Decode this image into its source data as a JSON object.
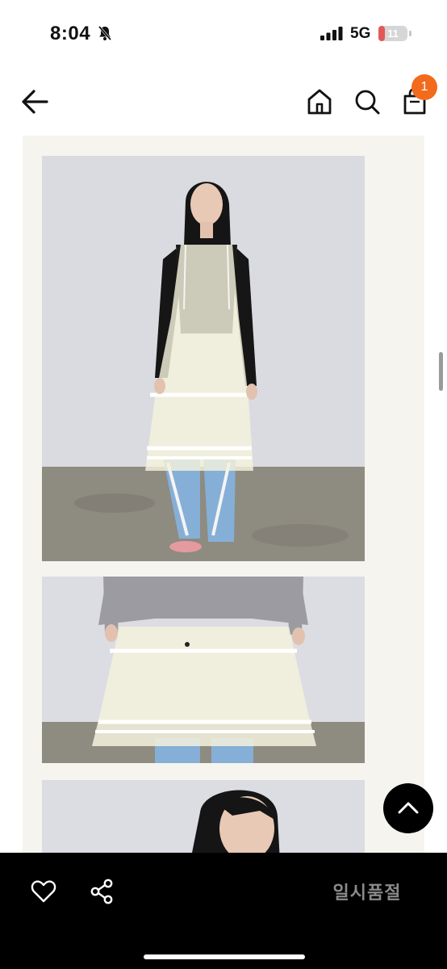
{
  "status_bar": {
    "time": "8:04",
    "network": "5G",
    "battery": "11",
    "battery_level": 0.11,
    "icons": [
      "mute-bell-icon",
      "signal-bars-icon",
      "battery-icon"
    ]
  },
  "header": {
    "icons": [
      "arrow-left-icon",
      "home-icon",
      "search-icon",
      "shopping-bag-icon"
    ],
    "cart_count": "1"
  },
  "bottom_bar": {
    "icons": [
      "heart-icon",
      "share-icon"
    ],
    "status_label": "일시품절"
  },
  "floating": {
    "icon": "chevron-up-icon"
  },
  "colors": {
    "accent": "#f26b1d",
    "content_bg": "#f5f4ef",
    "bottom_bar": "#000000",
    "soldout_text": "#8a8a8a"
  }
}
